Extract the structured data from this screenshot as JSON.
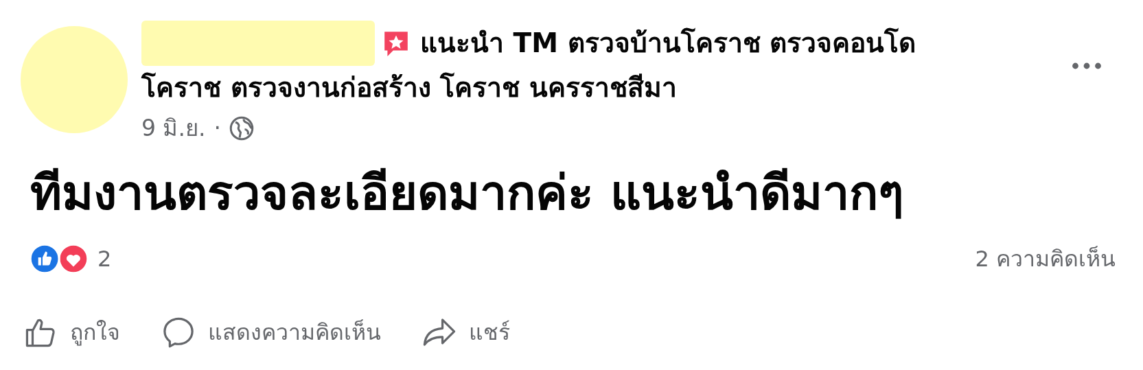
{
  "post": {
    "headline_lines": [
      "แนะนำ TM ตรวจบ้านโคราช ตรวจคอนโด",
      "โคราช ตรวจงานก่อสร้าง โคราช นครราชสีมา"
    ],
    "date": "9 มิ.ย.",
    "separator": "·",
    "body": "ทีมงานตรวจละเอียดมากค่ะ แนะนำดีมากๆ",
    "reaction_count": "2",
    "comment_count": "2 ความคิดเห็น"
  },
  "actions": [
    {
      "kind": "like",
      "label": "ถูกใจ"
    },
    {
      "kind": "comment",
      "label": "แสดงความคิดเห็น"
    },
    {
      "kind": "share",
      "label": "แชร์"
    }
  ]
}
